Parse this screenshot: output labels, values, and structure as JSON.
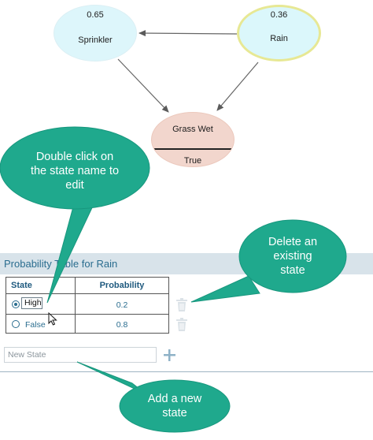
{
  "network": {
    "sprinkler": {
      "value": "0.65",
      "label": "Sprinkler"
    },
    "rain": {
      "value": "0.36",
      "label": "Rain"
    },
    "grass": {
      "label": "Grass Wet",
      "state": "True"
    }
  },
  "callouts": {
    "edit": [
      "Double click on",
      "the state name to",
      "edit"
    ],
    "delete": [
      "Delete an",
      "existing",
      "state"
    ],
    "add": [
      "Add a new",
      "state"
    ]
  },
  "panel": {
    "title": "Probability Table for Rain",
    "columns": [
      "State",
      "Probability"
    ],
    "rows": [
      {
        "state": "High",
        "probability": "0.2",
        "selected": true
      },
      {
        "state": "False",
        "probability": "0.8",
        "selected": false
      }
    ],
    "new_state_placeholder": "New State",
    "add_icon": "plus-icon",
    "delete_icon": "trash-icon"
  },
  "colors": {
    "callout": "#1fa98d",
    "accent": "#2a6d8f",
    "header_bg": "#d8e3ea"
  }
}
